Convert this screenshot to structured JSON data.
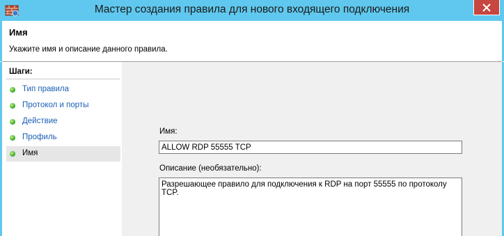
{
  "window": {
    "title": "Мастер создания правила для нового входящего подключения",
    "app_icon": "firewall-icon",
    "close_icon": "close-icon",
    "accent_color": "#60c8ee",
    "close_color": "#c7463f"
  },
  "header": {
    "title": "Имя",
    "description": "Укажите имя и описание данного правила."
  },
  "sidebar": {
    "steps_title": "Шаги:",
    "steps": [
      {
        "label": "Тип правила",
        "status": "complete"
      },
      {
        "label": "Протокол и порты",
        "status": "complete"
      },
      {
        "label": "Действие",
        "status": "complete"
      },
      {
        "label": "Профиль",
        "status": "complete"
      },
      {
        "label": "Имя",
        "status": "current"
      }
    ]
  },
  "form": {
    "name_label": "Имя:",
    "name_value": "ALLOW RDP 55555 TCP",
    "description_label": "Описание (необязательно):",
    "description_value": "Разрешающее правило для подключения к RDP на порт 55555 по протоколу TCP."
  }
}
